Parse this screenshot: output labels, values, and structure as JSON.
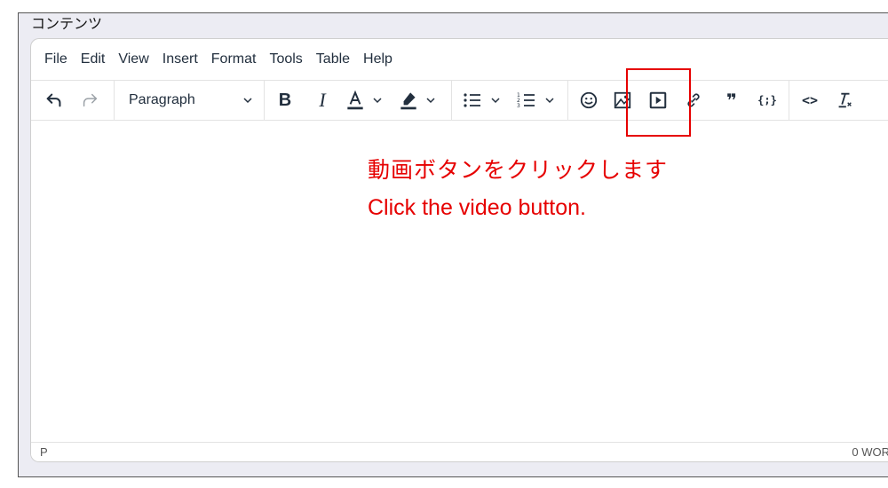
{
  "frame": {
    "title": "コンテンツ"
  },
  "menubar": {
    "items": [
      {
        "label": "File"
      },
      {
        "label": "Edit"
      },
      {
        "label": "View"
      },
      {
        "label": "Insert"
      },
      {
        "label": "Format"
      },
      {
        "label": "Tools"
      },
      {
        "label": "Table"
      },
      {
        "label": "Help"
      }
    ]
  },
  "toolbar": {
    "block_format": "Paragraph",
    "icons": [
      "undo-icon",
      "redo-icon",
      "bold-icon",
      "italic-icon",
      "text-color-icon",
      "highlight-icon",
      "bullet-list-icon",
      "numbered-list-icon",
      "emoji-icon",
      "image-icon",
      "video-icon",
      "link-icon",
      "blockquote-icon",
      "code-sample-icon",
      "source-code-icon",
      "clear-formatting-icon"
    ],
    "bold_glyph": "B",
    "italic_glyph": "I",
    "quote_glyph": "❞",
    "code_sample_glyph": "{;}",
    "source_code_glyph": "<>"
  },
  "annotation": {
    "japanese": "動画ボタンをクリックします",
    "english": "Click the video button.",
    "color": "#e60000"
  },
  "statusbar": {
    "path": "P",
    "word_count": "0 WOR"
  }
}
